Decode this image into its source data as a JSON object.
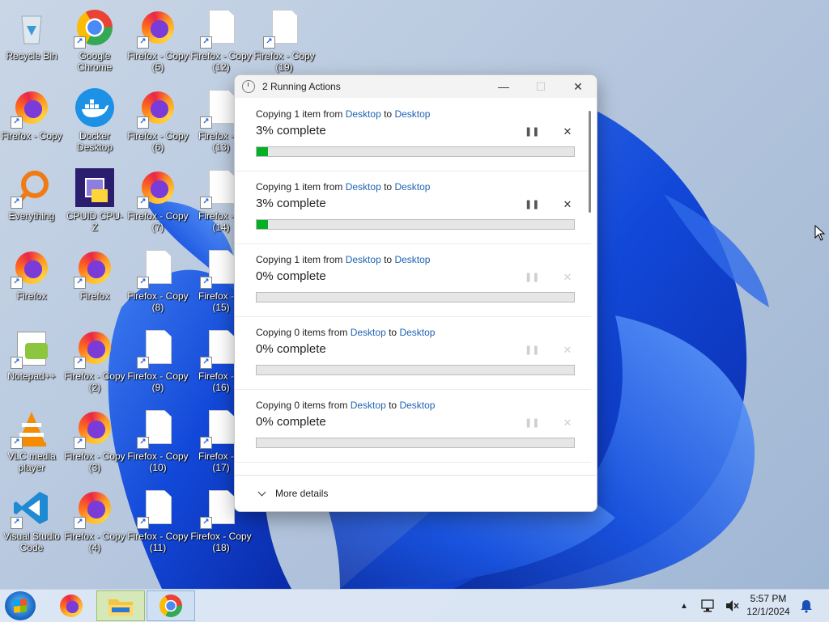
{
  "desktop": {
    "icons": [
      {
        "name": "recycle-bin",
        "label": "Recycle Bin",
        "kind": "recycle"
      },
      {
        "name": "google-chrome",
        "label": "Google Chrome",
        "kind": "chrome"
      },
      {
        "name": "firefox-copy-5",
        "label": "Firefox - Copy (5)",
        "kind": "firefox"
      },
      {
        "name": "firefox-copy-12",
        "label": "Firefox - Copy (12)",
        "kind": "file"
      },
      {
        "name": "firefox-copy-19",
        "label": "Firefox - Copy (19)",
        "kind": "file"
      },
      {
        "name": "firefox-copy",
        "label": "Firefox - Copy",
        "kind": "firefox"
      },
      {
        "name": "docker-desktop",
        "label": "Docker Desktop",
        "kind": "docker"
      },
      {
        "name": "firefox-copy-6",
        "label": "Firefox - Copy (6)",
        "kind": "firefox"
      },
      {
        "name": "firefox-copy-13",
        "label": "Firefox - C (13)",
        "kind": "file"
      },
      {
        "name": "everything",
        "label": "Everything",
        "kind": "everything"
      },
      {
        "name": "cpuid-cpu-z",
        "label": "CPUID CPU-Z",
        "kind": "cpuz"
      },
      {
        "name": "firefox-copy-7",
        "label": "Firefox - Copy (7)",
        "kind": "firefox"
      },
      {
        "name": "firefox-copy-14",
        "label": "Firefox - C (14)",
        "kind": "file"
      },
      {
        "name": "firefox",
        "label": "Firefox",
        "kind": "firefox"
      },
      {
        "name": "firefox-2nd",
        "label": "Firefox",
        "kind": "firefox"
      },
      {
        "name": "firefox-copy-8",
        "label": "Firefox - Copy (8)",
        "kind": "file"
      },
      {
        "name": "firefox-copy-15",
        "label": "Firefox - C (15)",
        "kind": "file"
      },
      {
        "name": "notepad-plus-plus",
        "label": "Notepad++",
        "kind": "notepad"
      },
      {
        "name": "firefox-copy-2",
        "label": "Firefox - Copy (2)",
        "kind": "firefox"
      },
      {
        "name": "firefox-copy-9",
        "label": "Firefox - Copy (9)",
        "kind": "file"
      },
      {
        "name": "firefox-copy-16",
        "label": "Firefox - C (16)",
        "kind": "file"
      },
      {
        "name": "vlc-media-player",
        "label": "VLC media player",
        "kind": "vlc"
      },
      {
        "name": "firefox-copy-3",
        "label": "Firefox - Copy (3)",
        "kind": "firefox"
      },
      {
        "name": "firefox-copy-10",
        "label": "Firefox - Copy (10)",
        "kind": "file"
      },
      {
        "name": "firefox-copy-17",
        "label": "Firefox - C (17)",
        "kind": "file"
      },
      {
        "name": "visual-studio-code",
        "label": "Visual Studio Code",
        "kind": "vscode"
      },
      {
        "name": "firefox-copy-4",
        "label": "Firefox - Copy (4)",
        "kind": "firefox"
      },
      {
        "name": "firefox-copy-11",
        "label": "Firefox - Copy (11)",
        "kind": "file"
      },
      {
        "name": "firefox-copy-18",
        "label": "Firefox - Copy (18)",
        "kind": "file"
      }
    ]
  },
  "dialog": {
    "title": "2 Running Actions",
    "items": [
      {
        "prefix": "Copying 1 item from ",
        "src": "Desktop",
        "mid": " to ",
        "dst": "Desktop",
        "status": "3% complete",
        "progress": 0.03,
        "active": true
      },
      {
        "prefix": "Copying 1 item from ",
        "src": "Desktop",
        "mid": " to ",
        "dst": "Desktop",
        "status": "3% complete",
        "progress": 0.03,
        "active": true
      },
      {
        "prefix": "Copying 1 item from ",
        "src": "Desktop",
        "mid": " to ",
        "dst": "Desktop",
        "status": "0% complete",
        "progress": 0,
        "active": false
      },
      {
        "prefix": "Copying 0 items from ",
        "src": "Desktop",
        "mid": " to ",
        "dst": "Desktop",
        "status": "0% complete",
        "progress": 0,
        "active": false
      },
      {
        "prefix": "Copying 0 items from ",
        "src": "Desktop",
        "mid": " to ",
        "dst": "Desktop",
        "status": "0% complete",
        "progress": 0,
        "active": false
      }
    ],
    "more_details": "More details"
  },
  "taskbar": {
    "time": "5:57 PM",
    "date": "12/1/2024"
  }
}
